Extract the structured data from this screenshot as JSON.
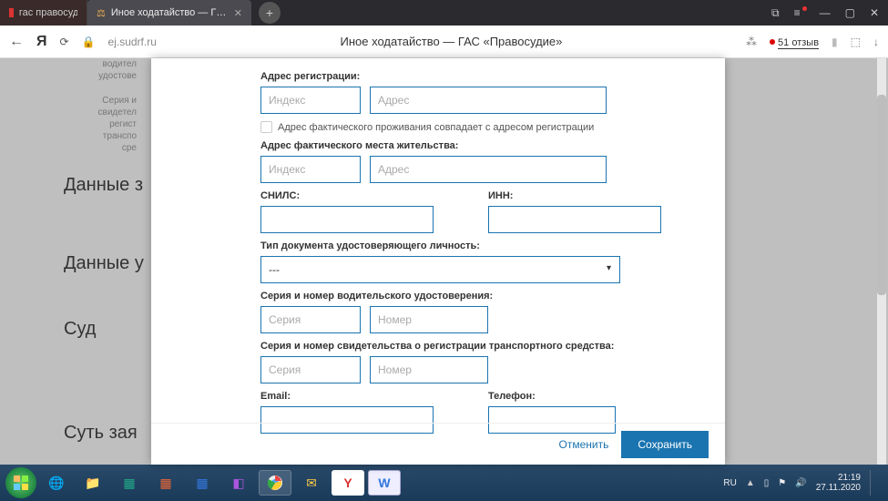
{
  "browser": {
    "tab_inactive": "гас правосудие официаль",
    "tab_active": "Иное ходатайство — Г…",
    "url": "ej.sudrf.ru",
    "page_title": "Иное ходатайство — ГАС «Правосудие»",
    "reviews": "51 отзыв"
  },
  "sidebar": {
    "line1": "водител",
    "line2": "удостове",
    "line3": "Серия и",
    "line4": "свидетел",
    "line5": "регист",
    "line6": "транспо",
    "line7": "сре",
    "sec1": "Данные з",
    "sec2": "Данные у",
    "sec3": "Суд",
    "sec4": "Суть зая"
  },
  "form": {
    "reg_label": "Адрес регистрации:",
    "idx_ph": "Индекс",
    "addr_ph": "Адрес",
    "cb_label": "Адрес фактического проживания совпадает с адресом регистрации",
    "fact_label": "Адрес фактического места жительства:",
    "snils_label": "СНИЛС:",
    "inn_label": "ИНН:",
    "doc_label": "Тип документа удостоверяющего личность:",
    "doc_sel": "---",
    "drv_label": "Серия и номер водительского удостоверения:",
    "ser_ph": "Серия",
    "num_ph": "Номер",
    "sts_label": "Серия и номер свидетельства о регистрации транспортного средства:",
    "email_label": "Email:",
    "phone_label": "Телефон:",
    "cancel": "Отменить",
    "save": "Сохранить"
  },
  "taskbar": {
    "lang": "RU",
    "time": "21:19",
    "date": "27.11.2020"
  }
}
